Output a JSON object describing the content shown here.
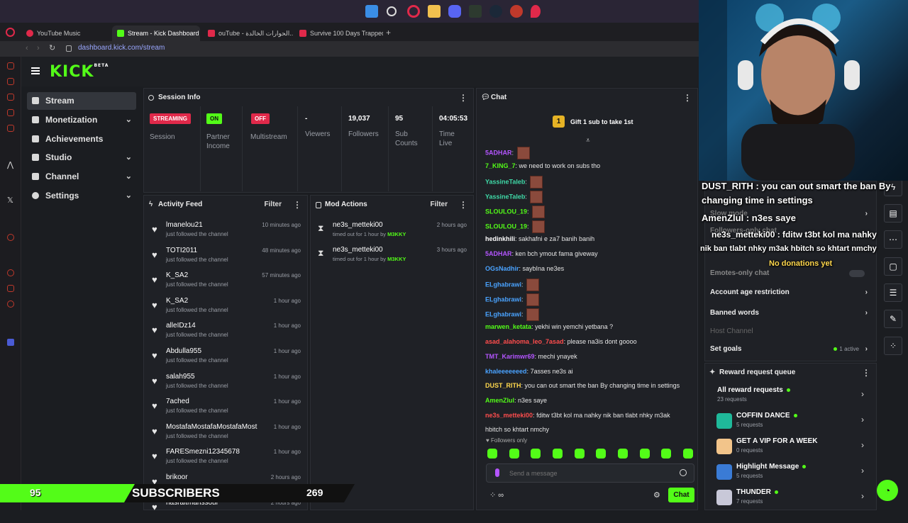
{
  "browser": {
    "tabs": [
      {
        "label": "YouTube Music",
        "active": false
      },
      {
        "label": "Stream - Kick Dashboard",
        "active": true
      },
      {
        "label": "ouTube - الحوارات الخالدة...",
        "active": false
      },
      {
        "label": "Survive 100 Days Trapped",
        "active": false
      }
    ],
    "url": "dashboard.kick.com/stream"
  },
  "brand": {
    "logo": "KICK",
    "beta": "BETA"
  },
  "nav": [
    {
      "label": "Stream",
      "icon": "radio-icon",
      "active": true,
      "expandable": false
    },
    {
      "label": "Monetization",
      "icon": "dollar-icon",
      "active": false,
      "expandable": true
    },
    {
      "label": "Achievements",
      "icon": "trophy-icon",
      "active": false,
      "expandable": false
    },
    {
      "label": "Studio",
      "icon": "studio-icon",
      "active": false,
      "expandable": true
    },
    {
      "label": "Channel",
      "icon": "channel-icon",
      "active": false,
      "expandable": true
    },
    {
      "label": "Settings",
      "icon": "gear-icon",
      "active": false,
      "expandable": true
    }
  ],
  "session": {
    "title": "Session Info",
    "stats": [
      {
        "value": "STREAMING",
        "label": "Session",
        "badge": "red"
      },
      {
        "value": "ON",
        "label": "Partner Income",
        "badge": "green"
      },
      {
        "value": "OFF",
        "label": "Multistream",
        "badge": "red"
      },
      {
        "value": "-",
        "label": "Viewers"
      },
      {
        "value": "19,037",
        "label": "Followers"
      },
      {
        "value": "95",
        "label": "Sub Counts"
      },
      {
        "value": "04:05:53",
        "label": "Time Live"
      }
    ]
  },
  "activity": {
    "title": "Activity Feed",
    "filter": "Filter",
    "items": [
      {
        "name": "lmanelou21",
        "text": "just followed the channel",
        "time": "10 minutes ago"
      },
      {
        "name": "TOTI2011",
        "text": "just followed the channel",
        "time": "48 minutes ago"
      },
      {
        "name": "K_SA2",
        "text": "just followed the channel",
        "time": "57 minutes ago"
      },
      {
        "name": "K_SA2",
        "text": "just followed the channel",
        "time": "1 hour ago"
      },
      {
        "name": "alleIDz14",
        "text": "just followed the channel",
        "time": "1 hour ago"
      },
      {
        "name": "Abdulla955",
        "text": "just followed the channel",
        "time": "1 hour ago"
      },
      {
        "name": "salah955",
        "text": "just followed the channel",
        "time": "1 hour ago"
      },
      {
        "name": "7ached",
        "text": "just followed the channel",
        "time": "1 hour ago"
      },
      {
        "name": "MostafaMostafaMostafaMost",
        "text": "just followed the channel",
        "time": "1 hour ago"
      },
      {
        "name": "FARESmezni12345678",
        "text": "just followed the channel",
        "time": "1 hour ago"
      },
      {
        "name": "brikoor",
        "text": "just followed the channel",
        "time": "2 hours ago"
      },
      {
        "name": "nasraitmanssour",
        "text": "",
        "time": "2 hours ago"
      }
    ]
  },
  "mod": {
    "title": "Mod Actions",
    "filter": "Filter",
    "items": [
      {
        "name": "ne3s_metteki00",
        "text": "timed out for 1 hour by",
        "by": "M3KKY",
        "time": "2 hours ago"
      },
      {
        "name": "ne3s_metteki00",
        "text": "timed out for 1 hour by",
        "by": "M3KKY",
        "time": "3 hours ago"
      }
    ]
  },
  "chat": {
    "title": "Chat",
    "gift_count": "1",
    "gift_text": "Gift 1 sub to take 1st",
    "messages": [
      {
        "user": "5ADHAR",
        "color": "#b455ff",
        "text": "",
        "emotes": 1
      },
      {
        "user": "7_KING_7",
        "color": "#53fc18",
        "text": "we need to work on subs tho",
        "emotes": 0
      },
      {
        "user": "YassineTaleb",
        "color": "#3fd9a7",
        "text": "",
        "emotes": 1
      },
      {
        "user": "YassineTaleb",
        "color": "#3fd9a7",
        "text": "",
        "emotes": 1
      },
      {
        "user": "SLOULOU_19",
        "color": "#53fc18",
        "text": "",
        "emotes": 1
      },
      {
        "user": "SLOULOU_19",
        "color": "#53fc18",
        "text": "",
        "emotes": 1
      },
      {
        "user": "hedinkhili",
        "color": "#ffffff",
        "text": "sakhafni e za7 banih banih",
        "emotes": 0
      },
      {
        "user": "5ADHAR",
        "color": "#b455ff",
        "text": "ken bch ymout fama giveway",
        "emotes": 0
      },
      {
        "user": "OGsNadhir",
        "color": "#4aa3ff",
        "text": "saybIna ne3es",
        "emotes": 0
      },
      {
        "user": "ELghabrawi",
        "color": "#4aa3ff",
        "text": "",
        "emotes": 1
      },
      {
        "user": "ELghabrawi",
        "color": "#4aa3ff",
        "text": "",
        "emotes": 1
      },
      {
        "user": "ELghabrawi",
        "color": "#4aa3ff",
        "text": "",
        "emotes": 1
      },
      {
        "user": "marwen_ketata",
        "color": "#53fc18",
        "text": "yekhi win yemchi yetbana ?",
        "emotes": 0
      },
      {
        "user": "asad_alahoma_leo_7asad",
        "color": "#ff4d4d",
        "text": "please na3is dont goooo",
        "emotes": 0
      },
      {
        "user": "TMT_Karimwr69",
        "color": "#b455ff",
        "text": "mechi ynayek",
        "emotes": 0
      },
      {
        "user": "khaleeeeeeed",
        "color": "#4aa3ff",
        "text": "7asses ne3s ai",
        "emotes": 0
      },
      {
        "user": "DUST_RITH",
        "color": "#ffd84d",
        "text": "you can out smart the ban By changing time in settings",
        "emotes": 0
      },
      {
        "user": "AmenZlul",
        "color": "#53fc18",
        "text": "n3es saye",
        "emotes": 0
      },
      {
        "user": "ne3s_metteki00",
        "color": "#ff4d4d",
        "text": "fditw t3bt kol ma nahky nik ban tlabt nhky m3ak",
        "emotes": 0
      },
      {
        "user": "",
        "color": "#ffffff",
        "text": "hbitch so khtart nmchy",
        "emotes": 0
      }
    ],
    "followers_only": "Followers only",
    "placeholder": "Send a message",
    "send": "Chat"
  },
  "settings_panel": {
    "slow_mode": "Slow mode",
    "followers_only": "Followers-only chat",
    "emotes_only": "Emotes-only chat",
    "account_age": "Account age restriction",
    "banned_words": "Banned words",
    "host_channel": "Host Channel",
    "set_goals": "Set goals",
    "goals_active": "1 active"
  },
  "rewards": {
    "title": "Reward request queue",
    "items": [
      {
        "title": "All reward requests",
        "sub": "23 requests",
        "color": "",
        "dot": true
      },
      {
        "title": "COFFIN DANCE",
        "sub": "5 requests",
        "color": "#1fb99a",
        "dot": true
      },
      {
        "title": "GET A VIP FOR A WEEK",
        "sub": "0 requests",
        "color": "#f2c48a",
        "dot": false
      },
      {
        "title": "Highlight Message",
        "sub": "5 requests",
        "color": "#3a7bd5",
        "dot": true
      },
      {
        "title": "THUNDER",
        "sub": "7 requests",
        "color": "#c8c8d8",
        "dot": true
      }
    ]
  },
  "overlay": {
    "line1": "DUST_RITH : you can out smart the ban By",
    "line2": "changing time in settings",
    "line3": "AmenZlul : n3es saye",
    "line4": "ne3s_metteki00 : fditw t3bt kol ma nahky",
    "line5": "nik ban tlabt nhky m3ak hbitch so khtart nmchy",
    "donations": "No donations yet",
    "sub_count": "95",
    "sub_label": "SUBSCRIBERS",
    "sub_goal": "269"
  },
  "colors": {
    "accent": "#53fc18",
    "live": "#e0294a",
    "panel": "#1f2126"
  }
}
